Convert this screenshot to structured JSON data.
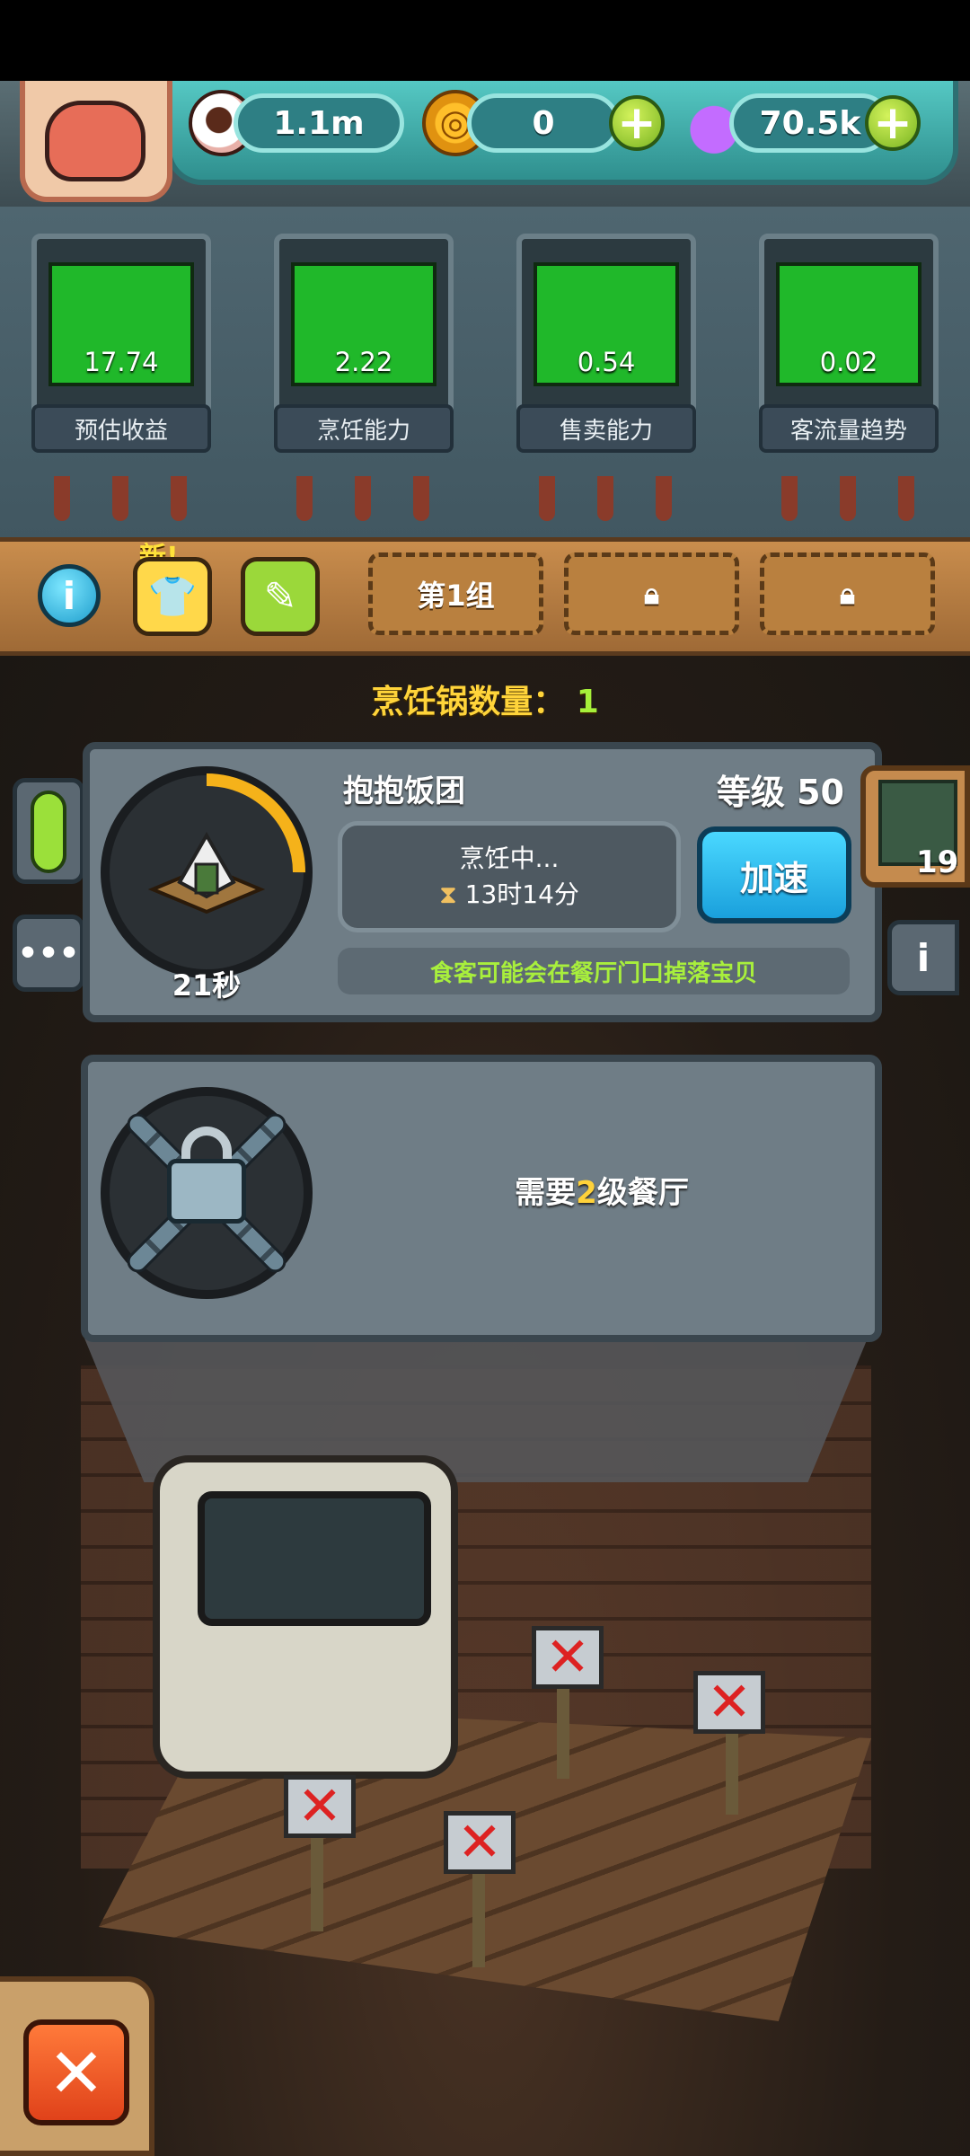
{
  "resources": {
    "eyeball_value": "1.1m",
    "coin_value": "0",
    "potion_value": "70.5k"
  },
  "stats": [
    {
      "value": "17.74",
      "label": "预估收益",
      "level": 1.0
    },
    {
      "value": "2.22",
      "label": "烹饪能力",
      "level": 1.0
    },
    {
      "value": "0.54",
      "label": "售卖能力",
      "level": 1.0
    },
    {
      "value": "0.02",
      "label": "客流量趋势",
      "level": 1.0
    }
  ],
  "toolbar": {
    "new_tag": "新!",
    "group_tab_1": "第1组"
  },
  "pot_count": {
    "label": "烹饪锅数量：",
    "value": "1"
  },
  "pot": {
    "food_name": "抱抱饭团",
    "level": "等级 50",
    "cook_timer": "21秒",
    "status_line1": "烹饪中...",
    "status_line2": "13时14分",
    "speed_label": "加速",
    "hint": "食客可能会在餐厅门口掉落宝贝",
    "progress": 0.25
  },
  "chest": {
    "count": "19"
  },
  "locked_slot": {
    "text_before": "需要",
    "highlight": "2",
    "text_after": "级餐厅"
  },
  "colors": {
    "stat_green": "#20b82a",
    "progress_ring": "#f5b21a",
    "speed_button": "#1aa0dc",
    "hint_text": "#a8ef3c",
    "highlight_yellow": "#ffd23a"
  }
}
